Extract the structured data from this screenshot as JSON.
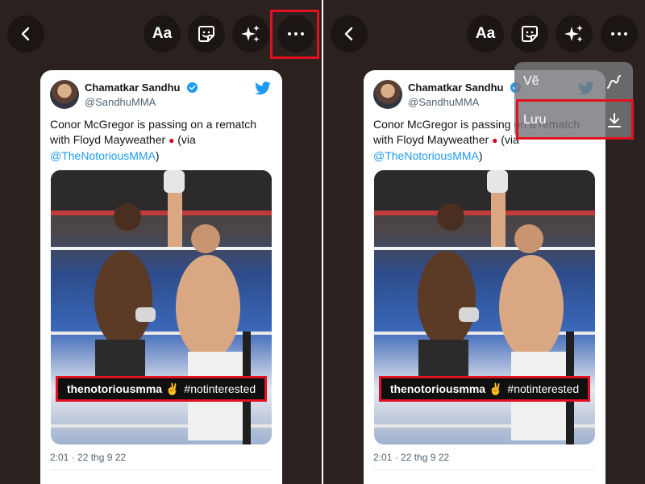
{
  "toolbar": {
    "text_label": "Aa"
  },
  "tweet": {
    "name": "Chamatkar Sandhu",
    "handle": "@SandhuMMA",
    "text_line1": "Conor McGregor is passing on a rematch",
    "text_line2": "with Floyd Mayweather",
    "text_via": "(via",
    "mention": "@TheNotoriousMMA",
    "close_paren": ")",
    "photo_caption_user": "thenotoriousmma ✌",
    "photo_caption_tag": "#notinterested",
    "timestamp": "2:01 · 22 thg 9 22"
  },
  "menu": {
    "items": [
      {
        "label": "Vẽ",
        "icon": "squiggle-draw-icon"
      },
      {
        "label": "Lưu",
        "icon": "download-icon"
      }
    ]
  },
  "colors": {
    "background": "#2b2220",
    "highlight": "#e3101f",
    "link": "#1d9bf0",
    "card": "#ffffff"
  }
}
